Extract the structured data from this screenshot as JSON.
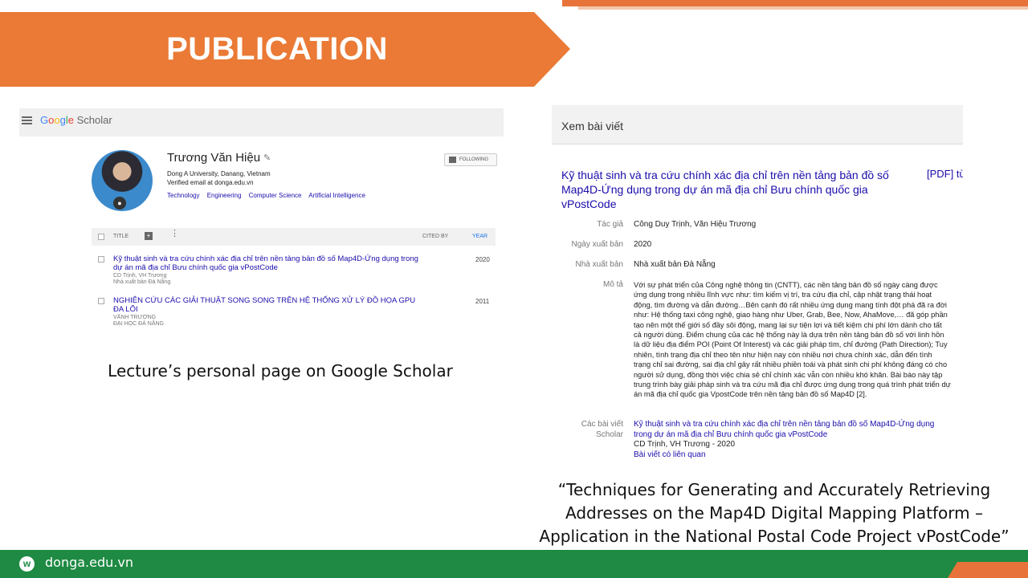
{
  "slide": {
    "title": "PUBLICATION",
    "caption_left": "Lecture’s personal page on Google Scholar",
    "caption_right_lines": [
      "“Techniques for Generating and Accurately Retrieving",
      "Addresses on the Map4D Digital Mapping Platform –",
      "Application in the National Postal Code Project vPostCode”"
    ],
    "footer_site": "donga.edu.vn",
    "footer_logo": "w"
  },
  "scholar": {
    "logo_parts": [
      "G",
      "o",
      "o",
      "g",
      "l",
      "e"
    ],
    "logo_suffix": " Scholar",
    "profile": {
      "name": "Trương Văn Hiệu",
      "affiliation": "Dong A University, Danang, Vietnam",
      "email": "Verified email at donga.edu.vn",
      "tags": [
        "Technology",
        "Engineering",
        "Computer Science",
        "Artificial Intelligence"
      ],
      "follow_label": "FOLLOWING"
    },
    "table": {
      "col_title": "TITLE",
      "col_cited": "CITED BY",
      "col_year": "YEAR"
    },
    "publications": [
      {
        "title": "Kỹ thuật sinh và tra cứu chính xác địa chỉ trên nền tảng bản đồ số Map4D-Ứng dụng trong dự án mã địa chỉ Bưu chính quốc gia vPostCode",
        "authors": "CD Trịnh, VH Trương",
        "venue": "Nhà xuất bản Đà Nẵng",
        "year": "2020"
      },
      {
        "title": "NGHIÊN CỨU CÁC GIẢI THUẬT SONG SONG TRÊN HỆ THỐNG XỬ LÝ ĐỒ HỌA GPU ĐA LÕI",
        "authors": "VÄNH TRƯƠNG",
        "venue": "ĐẠI HỌC ĐÀ NẴNG",
        "year": "2011"
      }
    ]
  },
  "article": {
    "header": "Xem bài viết",
    "title": "Kỹ thuật sinh và tra cứu chính xác địa chỉ trên nền tảng bản đồ số Map4D-Ứng dụng trong dự án mã địa chỉ Bưu chính quốc gia vPostCode",
    "pdf_link": "[PDF] từ",
    "fields": {
      "authors_label": "Tác giả",
      "authors": "Công Duy Trịnh, Văn Hiệu Trương",
      "date_label": "Ngày xuất bản",
      "date": "2020",
      "publisher_label": "Nhà xuất bản",
      "publisher": "Nhà xuất bản Đà Nẵng",
      "desc_label": "Mô tả",
      "description": "Với sự phát triển của Công nghệ thông tin (CNTT), các nền tảng bản đồ số ngày càng được ứng dụng trong nhiều lĩnh vực như: tìm kiếm vị trí, tra cứu địa chỉ, cập nhật trạng thái hoạt động, tìm đường và dẫn đường…Bên cạnh đó rất nhiều ứng dụng mang tính đột phá đã ra đời như: Hệ thống taxi công nghệ, giao hàng như Uber, Grab, Bee, Now, AhaMove,… đã góp phần tạo nên một thế giới số đầy sôi động, mang lại sự tiện lợi và tiết kiệm chi phí lớn dành cho tất cả người dùng. Điểm chung của các hệ thống này là dựa trên nền tảng bản đồ số với linh hồn là dữ liệu địa điểm POI (Point Of Interest) và các giải pháp tìm, chỉ đường (Path Direction); Tuy nhiên, tình trạng địa chỉ theo tên như hiện nay còn nhiều nơi chưa chính xác, dẫn đến tình trạng chỉ sai đường, sai địa chỉ gây rất nhiều phiền toái và phát sinh chi phí không đáng có cho người sử dụng, đồng thời việc chia sẻ chỉ chính xác vẫn còn nhiều khó khăn. Bài báo này tập trung trình bày giải pháp sinh và tra cứu mã địa chỉ được ứng dụng trong quá trình phát triển dự án mã địa chỉ quốc gia VpostCode trên nền tảng bản đồ số Map4D [2].",
      "scholar_label_1": "Các bài viết",
      "scholar_label_2": "Scholar",
      "scholar_link": "Kỹ thuật sinh và tra cứu chính xác địa chỉ trên nền tảng bản đồ số Map4D-Ứng dụng trong dự án mã địa chỉ Bưu chính quốc gia vPostCode",
      "scholar_authors": "CD Trịnh, VH Trương - 2020",
      "related_link": "Bài viết có liên quan"
    }
  },
  "colors": {
    "orange": "#ea7a35",
    "green": "#1e8a43",
    "link_blue": "#1a0dab"
  }
}
